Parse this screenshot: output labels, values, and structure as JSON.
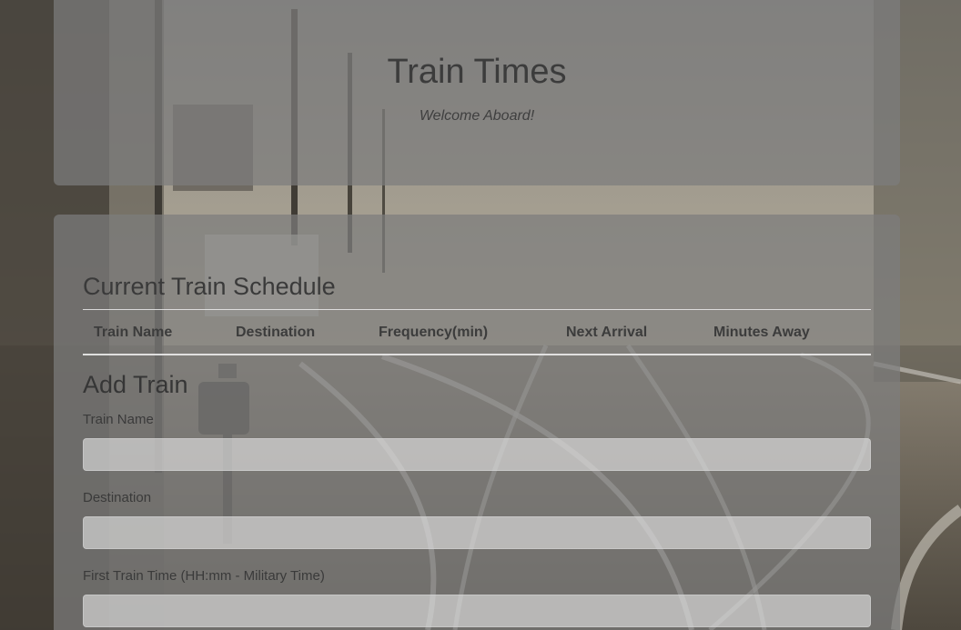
{
  "header": {
    "title": "Train Times",
    "subtitle": "Welcome Aboard!"
  },
  "schedule": {
    "heading": "Current Train Schedule",
    "columns": [
      "Train Name",
      "Destination",
      "Frequency(min)",
      "Next Arrival",
      "Minutes Away"
    ],
    "rows": []
  },
  "add_train": {
    "heading": "Add Train",
    "fields": [
      {
        "label": "Train Name",
        "value": "",
        "placeholder": ""
      },
      {
        "label": "Destination",
        "value": "",
        "placeholder": ""
      },
      {
        "label": "First Train Time (HH:mm - Military Time)",
        "value": "",
        "placeholder": ""
      }
    ]
  },
  "colors": {
    "panel": "#7d7d7d",
    "text": "#3c3c3c",
    "input": "#e8e8e8"
  }
}
